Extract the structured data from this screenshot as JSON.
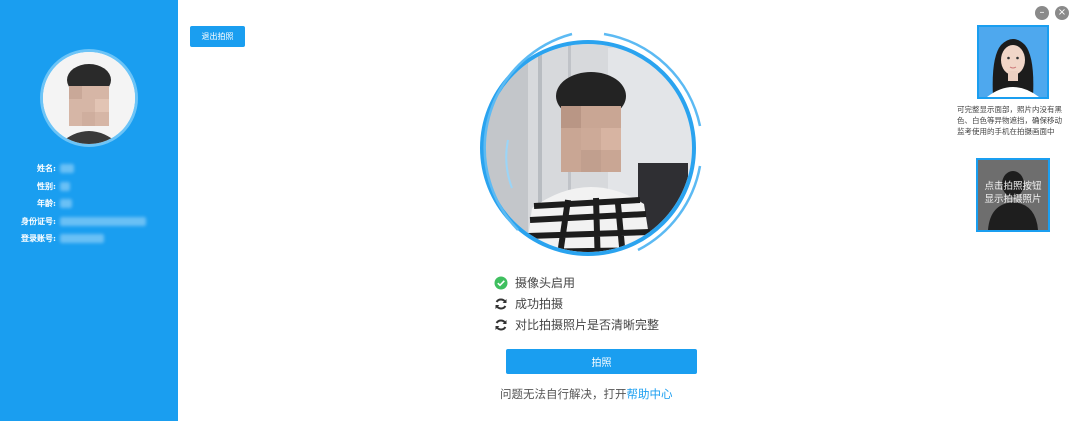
{
  "colors": {
    "accent": "#1a9ef0",
    "success": "#3fbf5f"
  },
  "sidebar": {
    "fields": [
      {
        "label": "姓名:"
      },
      {
        "label": "性别:"
      },
      {
        "label": "年龄:"
      },
      {
        "label": "身份证号:"
      },
      {
        "label": "登录账号:"
      }
    ]
  },
  "toolbar": {
    "exit_label": "退出拍照"
  },
  "window": {
    "minimize_icon": "minimize-icon",
    "close_icon": "close-icon"
  },
  "status": [
    {
      "text": "摄像头启用",
      "icon": "check-circle-icon",
      "state": "done"
    },
    {
      "text": "成功拍摄",
      "icon": "refresh-icon",
      "state": "pending"
    },
    {
      "text": "对比拍摄照片是否清晰完整",
      "icon": "refresh-icon",
      "state": "pending"
    }
  ],
  "actions": {
    "shoot_label": "拍照"
  },
  "help": {
    "prefix": "问题无法自行解决，打开",
    "link": "帮助中心"
  },
  "guide": {
    "tip": "可完整显示面部，照片内没有黑色、白色等异物遮挡，确保移动监考使用的手机在拍摄画面中",
    "placeholder_line1": "点击拍照按钮",
    "placeholder_line2": "显示拍摄照片"
  }
}
